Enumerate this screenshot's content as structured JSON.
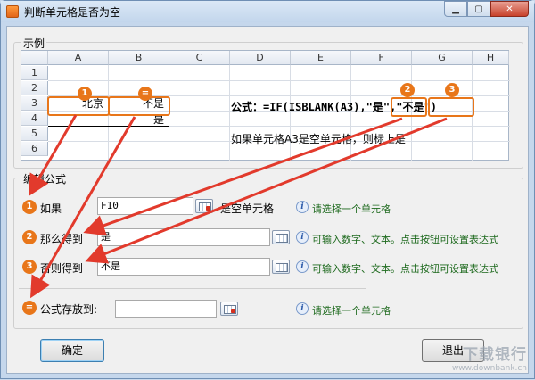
{
  "window": {
    "title": "判断单元格是否为空"
  },
  "example_group": {
    "title": "示例"
  },
  "sheet": {
    "columns": [
      "A",
      "B",
      "C",
      "D",
      "E",
      "F",
      "G",
      "H"
    ],
    "rows": [
      "1",
      "2",
      "3",
      "4",
      "5",
      "6"
    ],
    "cells": {
      "A3": "北京",
      "B3": "不是",
      "B4": "是"
    },
    "formula": "公式：=IF(ISBLANK(A3),\"是\",\"不是\")",
    "formula_prefix": "公式：=IF(ISBLANK(A3),",
    "formula_arg_true": "\"是\"",
    "formula_comma": ",",
    "formula_arg_false": "\"不是\"",
    "formula_close": ")",
    "note": "如果单元格A3是空单元格，则标上是"
  },
  "badges": {
    "one": "1",
    "eq": "=",
    "two": "2",
    "three": "3"
  },
  "edit_group": {
    "title": "编辑公式"
  },
  "rows": {
    "if": {
      "badge": "1",
      "label": "如果",
      "value": "F10",
      "suffix": "是空单元格",
      "hint": "请选择一个单元格"
    },
    "then": {
      "badge": "2",
      "label": "那么得到",
      "value": "是",
      "hint": "可输入数字、文本。点击按钮可设置表达式"
    },
    "else": {
      "badge": "3",
      "label": "否则得到",
      "value": "不是",
      "hint": "可输入数字、文本。点击按钮可设置表达式"
    },
    "store": {
      "badge": "=",
      "label": "公式存放到:",
      "value": "",
      "hint": "请选择一个单元格"
    }
  },
  "buttons": {
    "ok": "确定",
    "cancel": "退出"
  },
  "watermark": {
    "big": "下载银行",
    "small": "www.downbank.cn"
  },
  "colors": {
    "accent_orange": "#e8761a",
    "arrow_red": "#e23a2c",
    "hint_green": "#1e6a1e"
  }
}
